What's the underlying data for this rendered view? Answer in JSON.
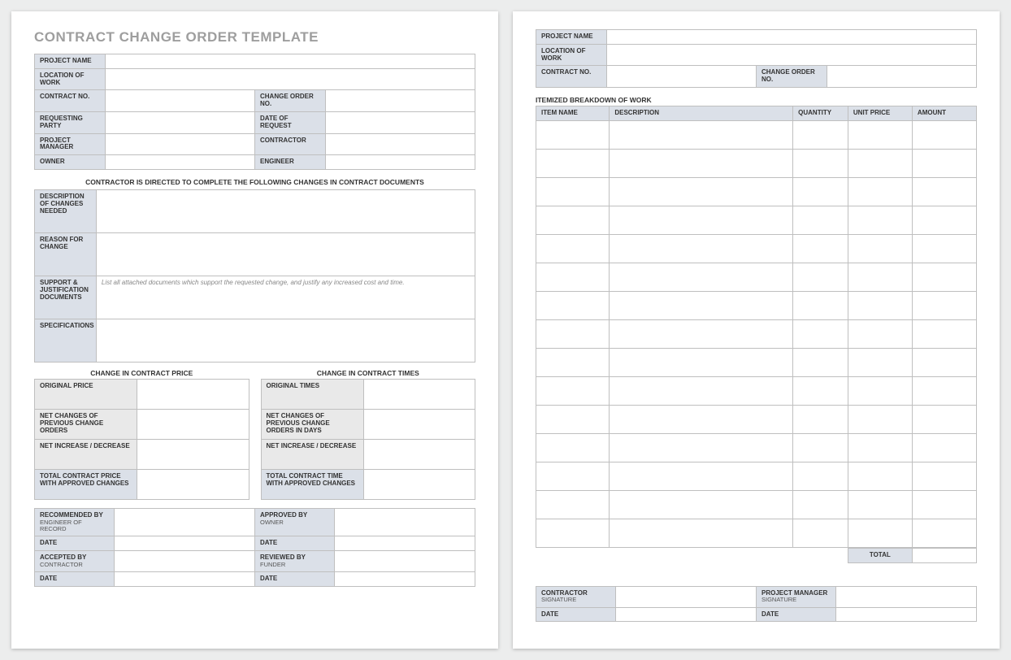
{
  "title": "CONTRACT CHANGE ORDER TEMPLATE",
  "hdr": {
    "projectName": "PROJECT NAME",
    "locationOfWork": "LOCATION OF WORK",
    "contractNo": "CONTRACT NO.",
    "changeOrderNo": "CHANGE ORDER NO.",
    "requestingParty": "REQUESTING PARTY",
    "dateOfRequest": "DATE OF REQUEST",
    "projectManager": "PROJECT MANAGER",
    "contractor": "CONTRACTOR",
    "owner": "OWNER",
    "engineer": "ENGINEER"
  },
  "directive": "CONTRACTOR IS DIRECTED TO COMPLETE THE FOLLOWING CHANGES IN CONTRACT DOCUMENTS",
  "desc": {
    "descChanges": "DESCRIPTION OF CHANGES NEEDED",
    "reason": "REASON FOR CHANGE",
    "support": "SUPPORT & JUSTIFICATION DOCUMENTS",
    "supportHint": "List all attached documents which support the requested change, and justify any increased cost and time.",
    "specs": "SPECIFICATIONS"
  },
  "price": {
    "title": "CHANGE IN CONTRACT PRICE",
    "original": "ORIGINAL PRICE",
    "netPrev": "NET CHANGES OF PREVIOUS CHANGE ORDERS",
    "netIncDec": "NET INCREASE / DECREASE",
    "total": "TOTAL CONTRACT PRICE WITH APPROVED CHANGES"
  },
  "times": {
    "title": "CHANGE IN CONTRACT TIMES",
    "original": "ORIGINAL TIMES",
    "netPrev": "NET CHANGES OF PREVIOUS CHANGE ORDERS IN DAYS",
    "netIncDec": "NET INCREASE / DECREASE",
    "total": "TOTAL CONTRACT TIME WITH APPROVED CHANGES"
  },
  "sign1": {
    "recommendedBy": "RECOMMENDED BY",
    "recommendedBySub": "ENGINEER OF RECORD",
    "approvedBy": "APPROVED BY",
    "approvedBySub": "OWNER",
    "acceptedBy": "ACCEPTED BY",
    "acceptedBySub": "CONTRACTOR",
    "reviewedBy": "REVIEWED BY",
    "reviewedBySub": "FUNDER",
    "date": "DATE"
  },
  "page2": {
    "itemized": "ITEMIZED BREAKDOWN OF WORK",
    "cols": {
      "itemName": "ITEM NAME",
      "description": "DESCRIPTION",
      "quantity": "QUANTITY",
      "unitPrice": "UNIT PRICE",
      "amount": "AMOUNT"
    },
    "total": "TOTAL",
    "sig": {
      "contractor": "CONTRACTOR",
      "projectManager": "PROJECT MANAGER",
      "signature": "SIGNATURE",
      "date": "DATE"
    }
  }
}
